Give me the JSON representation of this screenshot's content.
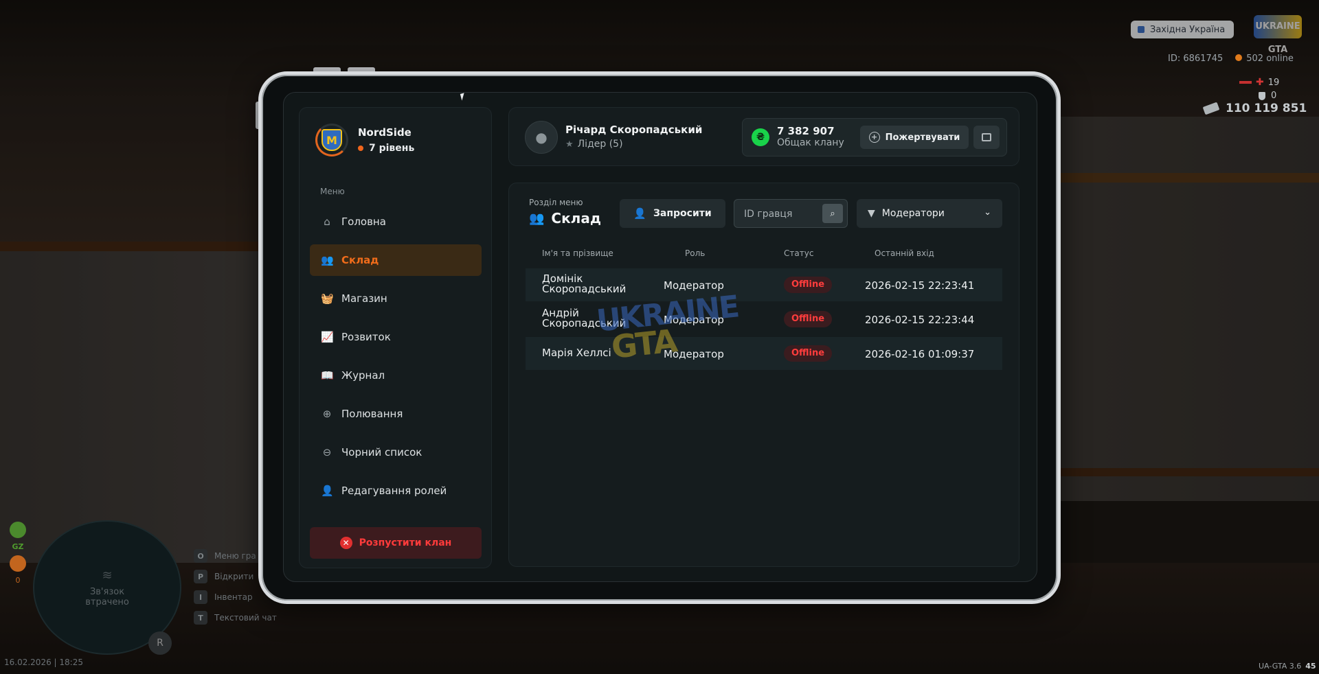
{
  "hud": {
    "server_name": "Західна Україна",
    "logo_text": "UKRAINE GTA",
    "player_id": "ID: 6861745",
    "online": "502 online",
    "health": "19",
    "armor": "0",
    "money": "110 119 851",
    "minimap_status": "Зв'язок втрачено",
    "badge_gz": "GZ",
    "badge_zero": "0",
    "hints": [
      {
        "key": "O",
        "label": "Меню гра"
      },
      {
        "key": "P",
        "label": "Відкрити"
      },
      {
        "key": "I",
        "label": "Інвентар"
      },
      {
        "key": "T",
        "label": "Текстовий чат"
      }
    ],
    "mic_key": "R",
    "datetime": "16.02.2026 | 18:25",
    "version": "UA-GTA 3.6",
    "version_extra": "45"
  },
  "clan": {
    "name": "NordSide",
    "level": "7 рівень",
    "emblem_letter": "M"
  },
  "sidebar": {
    "caption": "Меню",
    "items": [
      {
        "label": "Головна",
        "icon": "home-icon",
        "glyph": "⌂",
        "active": false
      },
      {
        "label": "Склад",
        "icon": "members-icon",
        "glyph": "👥",
        "active": true
      },
      {
        "label": "Магазин",
        "icon": "basket-icon",
        "glyph": "🧺",
        "active": false
      },
      {
        "label": "Розвиток",
        "icon": "chart-icon",
        "glyph": "📈",
        "active": false
      },
      {
        "label": "Журнал",
        "icon": "book-icon",
        "glyph": "📖",
        "active": false
      },
      {
        "label": "Полювання",
        "icon": "crosshair-icon",
        "glyph": "⊕",
        "active": false
      },
      {
        "label": "Чорний список",
        "icon": "block-icon",
        "glyph": "⊖",
        "active": false
      },
      {
        "label": "Редагування ролей",
        "icon": "user-edit-icon",
        "glyph": "👤",
        "active": false
      }
    ],
    "disband_label": "Розпустити клан"
  },
  "user": {
    "name": "Річард Скоропадський",
    "role": "Лідер (5)"
  },
  "balance": {
    "value": "7 382 907",
    "caption": "Общак клану",
    "currency_symbol": "₴",
    "donate_label": "Пожертвувати"
  },
  "section": {
    "caption": "Розділ меню",
    "title": "Склад",
    "invite_label": "Запросити",
    "search_placeholder": "ID гравця",
    "filter_value": "Модератори"
  },
  "table": {
    "headers": [
      "Ім'я та прізвище",
      "Роль",
      "Статус",
      "Останній вхід"
    ],
    "rows": [
      {
        "name": "Домінік Скоропадський",
        "role": "Модератор",
        "status": "Offline",
        "last": "2026-02-15 22:23:41"
      },
      {
        "name": "Андрій Скоропадський",
        "role": "Модератор",
        "status": "Offline",
        "last": "2026-02-15 22:23:44"
      },
      {
        "name": "Марія Хеллсі",
        "role": "Модератор",
        "status": "Offline",
        "last": "2026-02-16 01:09:37"
      }
    ]
  },
  "watermark": {
    "line1": "UKRAINE",
    "line2": "GTA"
  },
  "colors": {
    "accent": "#f06c1a",
    "danger": "#ff3d3d",
    "money": "#19d34a",
    "panel": "#151c1e"
  }
}
